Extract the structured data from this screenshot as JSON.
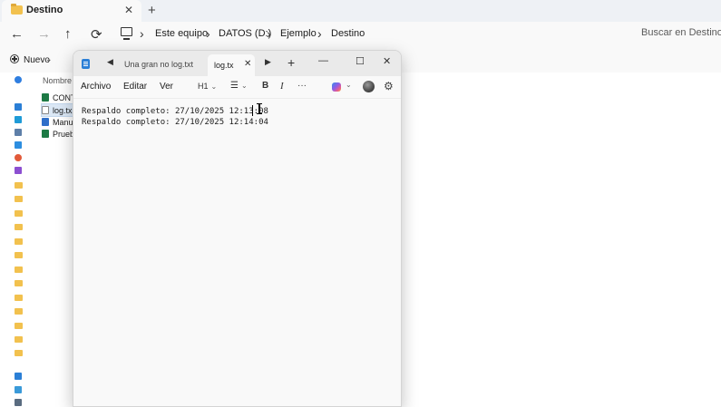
{
  "explorer": {
    "tab_title": "Destino",
    "tab_close": "✕",
    "new_tab": "+",
    "nav": {
      "back": "←",
      "forward": "→",
      "up": "↑",
      "refresh": "⟳"
    },
    "breadcrumb": [
      "Este equipo",
      "DATOS (D:)",
      "Ejemplo",
      "Destino"
    ],
    "breadcrumb_sep": "›",
    "search_placeholder": "Buscar en Destino",
    "new_label": "Nuevo",
    "new_chevron": "⌄",
    "column_name": "Nombre",
    "files": [
      {
        "name": "CONT",
        "icon": "excel-file-icon",
        "color": "#1d7a45"
      },
      {
        "name": "log.tx",
        "icon": "text-file-icon",
        "color": "#8a8a8a",
        "selected": true
      },
      {
        "name": "Manu",
        "icon": "script-file-icon",
        "color": "#2f6fc9"
      },
      {
        "name": "Prueb",
        "icon": "excel-file-icon",
        "color": "#1d7a45"
      }
    ]
  },
  "notepad": {
    "scroll_left": "◀",
    "inactive_tab": "Una gran no   log.txt",
    "active_tab": "log.tx",
    "active_tab_close": "✕",
    "scroll_right": "▶",
    "new_tab": "+",
    "window_buttons": {
      "minimize": "—",
      "maximize": "☐",
      "close": "✕"
    },
    "menu": {
      "file": "Archivo",
      "edit": "Editar",
      "view": "Ver"
    },
    "toolbar": {
      "heading": "H1",
      "list": "☰",
      "bold": "B",
      "italic": "I",
      "more": "···",
      "chevron": "⌄",
      "settings": "⚙"
    },
    "lines": [
      "Respaldo completo: 27/10/2025 12:13:08",
      "Respaldo completo: 27/10/2025 12:14:04"
    ]
  },
  "colors": {
    "accent": "#2b7fd6",
    "folder": "#f2c14e",
    "selection": "#dbe8f6"
  }
}
